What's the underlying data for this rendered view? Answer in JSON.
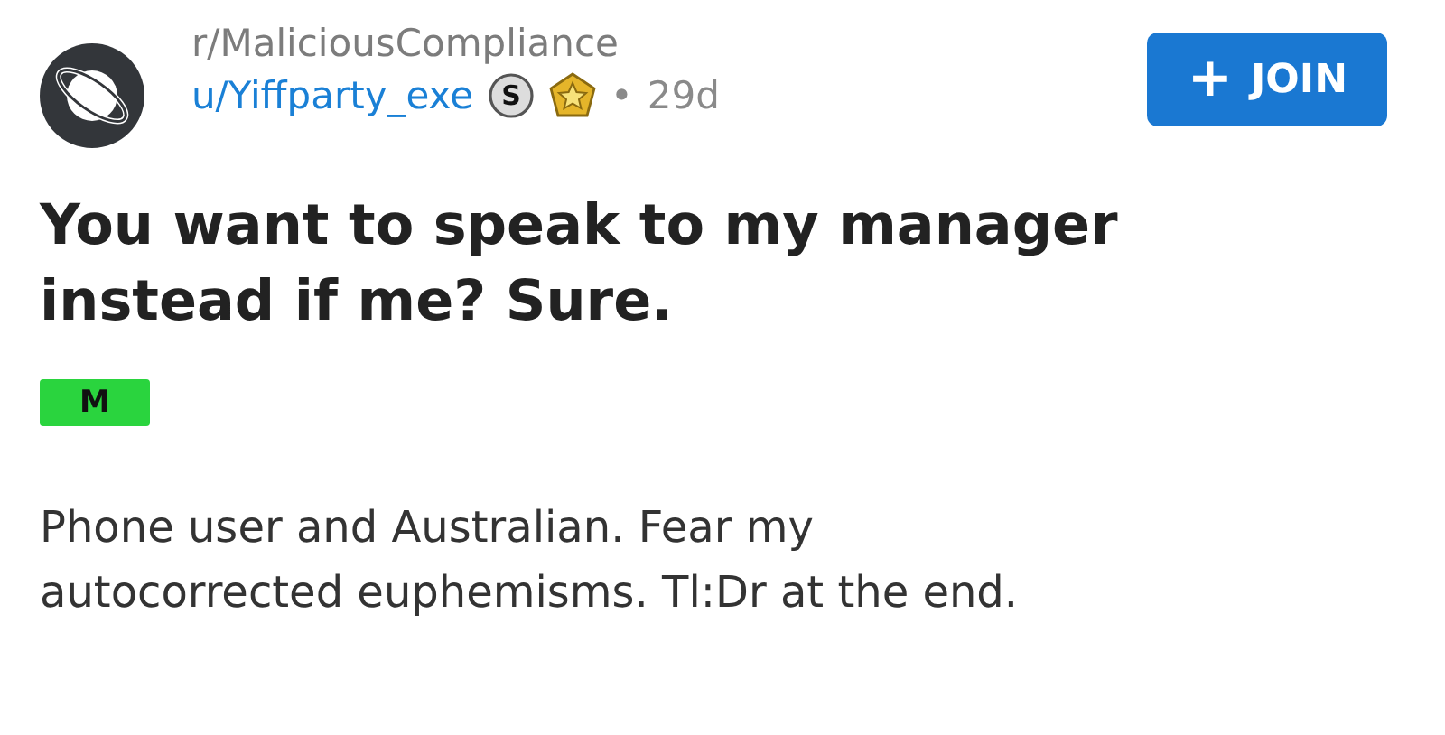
{
  "post": {
    "subreddit": "r/MaliciousCompliance",
    "author": "u/Yiffparty_exe",
    "badges": [
      {
        "kind": "silver",
        "text": "S"
      },
      {
        "kind": "gold"
      }
    ],
    "separator": "•",
    "age": "29d",
    "join_button": {
      "icon": "+",
      "label": "JOIN"
    },
    "title": "You want to speak to my manager instead if me? Sure.",
    "flair": {
      "label": "M",
      "color": "#2ad43e"
    },
    "body": "Phone user and Australian. Fear my autocorrected euphemisms. Tl:Dr at the end."
  }
}
